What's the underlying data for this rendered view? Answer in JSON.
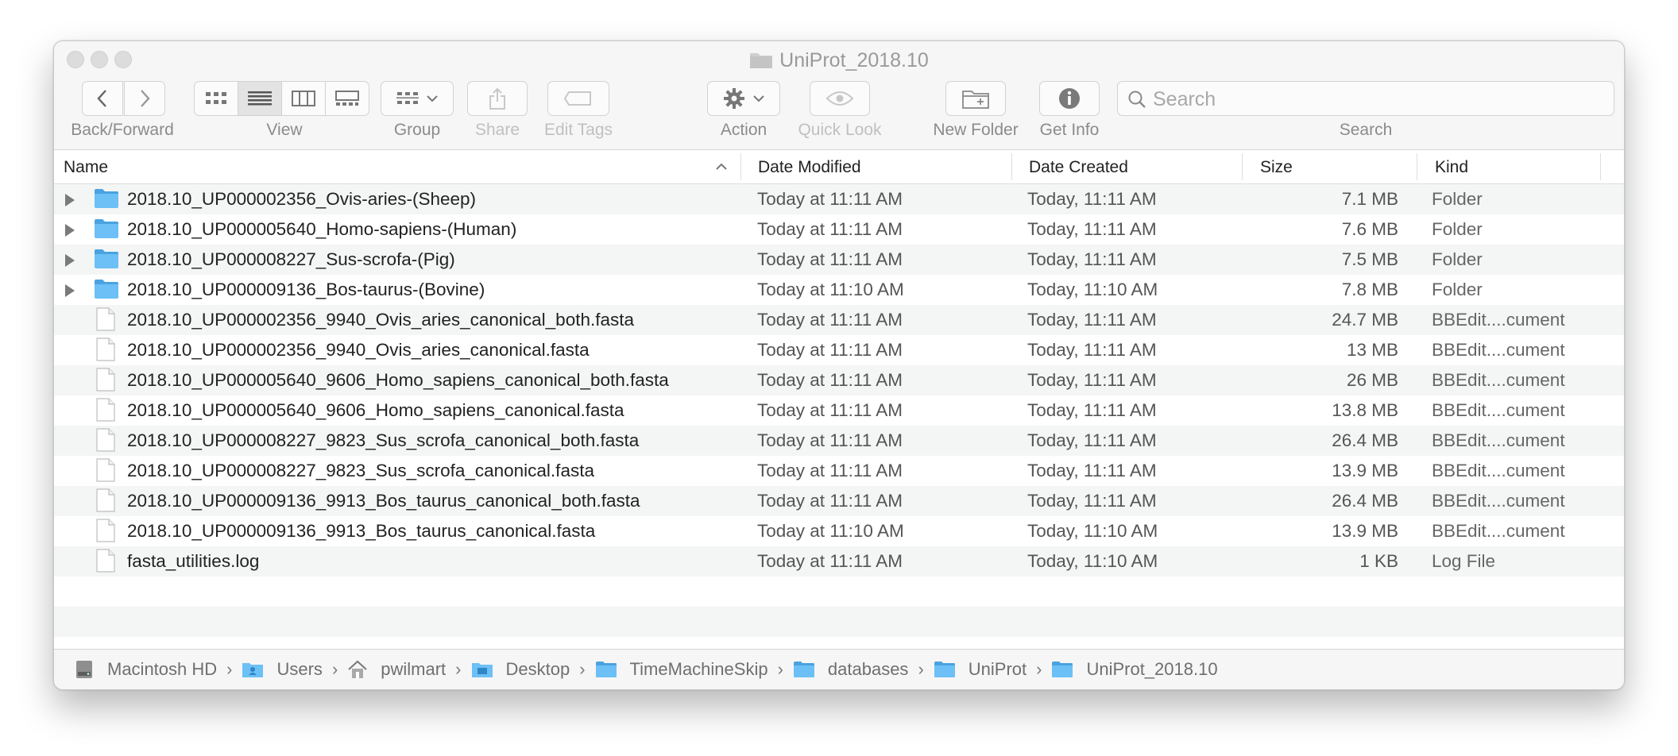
{
  "window": {
    "title": "UniProt_2018.10"
  },
  "toolbar": {
    "back_forward_label": "Back/Forward",
    "view_label": "View",
    "group_label": "Group",
    "share_label": "Share",
    "edit_tags_label": "Edit Tags",
    "action_label": "Action",
    "quick_look_label": "Quick Look",
    "new_folder_label": "New Folder",
    "get_info_label": "Get Info",
    "search_label": "Search",
    "search_placeholder": "Search",
    "selected_view": "list"
  },
  "columns": {
    "name": "Name",
    "date_modified": "Date Modified",
    "date_created": "Date Created",
    "size": "Size",
    "kind": "Kind",
    "sort_column": "Name",
    "sort_direction": "ascending"
  },
  "files": [
    {
      "name": "2018.10_UP000002356_Ovis-aries-(Sheep)",
      "modified": "Today at 11:11 AM",
      "created": "Today, 11:11 AM",
      "size": "7.1 MB",
      "kind": "Folder",
      "type": "folder"
    },
    {
      "name": "2018.10_UP000005640_Homo-sapiens-(Human)",
      "modified": "Today at 11:11 AM",
      "created": "Today, 11:11 AM",
      "size": "7.6 MB",
      "kind": "Folder",
      "type": "folder"
    },
    {
      "name": "2018.10_UP000008227_Sus-scrofa-(Pig)",
      "modified": "Today at 11:11 AM",
      "created": "Today, 11:11 AM",
      "size": "7.5 MB",
      "kind": "Folder",
      "type": "folder"
    },
    {
      "name": "2018.10_UP000009136_Bos-taurus-(Bovine)",
      "modified": "Today at 11:10 AM",
      "created": "Today, 11:10 AM",
      "size": "7.8 MB",
      "kind": "Folder",
      "type": "folder"
    },
    {
      "name": "2018.10_UP000002356_9940_Ovis_aries_canonical_both.fasta",
      "modified": "Today at 11:11 AM",
      "created": "Today, 11:11 AM",
      "size": "24.7 MB",
      "kind": "BBEdit....cument",
      "type": "file"
    },
    {
      "name": "2018.10_UP000002356_9940_Ovis_aries_canonical.fasta",
      "modified": "Today at 11:11 AM",
      "created": "Today, 11:11 AM",
      "size": "13 MB",
      "kind": "BBEdit....cument",
      "type": "file"
    },
    {
      "name": "2018.10_UP000005640_9606_Homo_sapiens_canonical_both.fasta",
      "modified": "Today at 11:11 AM",
      "created": "Today, 11:11 AM",
      "size": "26 MB",
      "kind": "BBEdit....cument",
      "type": "file"
    },
    {
      "name": "2018.10_UP000005640_9606_Homo_sapiens_canonical.fasta",
      "modified": "Today at 11:11 AM",
      "created": "Today, 11:11 AM",
      "size": "13.8 MB",
      "kind": "BBEdit....cument",
      "type": "file"
    },
    {
      "name": "2018.10_UP000008227_9823_Sus_scrofa_canonical_both.fasta",
      "modified": "Today at 11:11 AM",
      "created": "Today, 11:11 AM",
      "size": "26.4 MB",
      "kind": "BBEdit....cument",
      "type": "file"
    },
    {
      "name": "2018.10_UP000008227_9823_Sus_scrofa_canonical.fasta",
      "modified": "Today at 11:11 AM",
      "created": "Today, 11:11 AM",
      "size": "13.9 MB",
      "kind": "BBEdit....cument",
      "type": "file"
    },
    {
      "name": "2018.10_UP000009136_9913_Bos_taurus_canonical_both.fasta",
      "modified": "Today at 11:11 AM",
      "created": "Today, 11:11 AM",
      "size": "26.4 MB",
      "kind": "BBEdit....cument",
      "type": "file"
    },
    {
      "name": "2018.10_UP000009136_9913_Bos_taurus_canonical.fasta",
      "modified": "Today at 11:10 AM",
      "created": "Today, 11:10 AM",
      "size": "13.9 MB",
      "kind": "BBEdit....cument",
      "type": "file"
    },
    {
      "name": "fasta_utilities.log",
      "modified": "Today at 11:11 AM",
      "created": "Today, 11:10 AM",
      "size": "1 KB",
      "kind": "Log File",
      "type": "file"
    }
  ],
  "path_bar": [
    {
      "label": "Macintosh HD",
      "icon": "hard-drive-icon"
    },
    {
      "label": "Users",
      "icon": "users-folder-icon"
    },
    {
      "label": "pwilmart",
      "icon": "home-icon"
    },
    {
      "label": "Desktop",
      "icon": "desktop-folder-icon"
    },
    {
      "label": "TimeMachineSkip",
      "icon": "folder-icon"
    },
    {
      "label": "databases",
      "icon": "folder-icon"
    },
    {
      "label": "UniProt",
      "icon": "folder-icon"
    },
    {
      "label": "UniProt_2018.10",
      "icon": "folder-icon"
    }
  ],
  "colors": {
    "folder": "#5db4ee",
    "toolbar_bg": "#f6f6f6",
    "row_alt": "#f4f5f5"
  }
}
